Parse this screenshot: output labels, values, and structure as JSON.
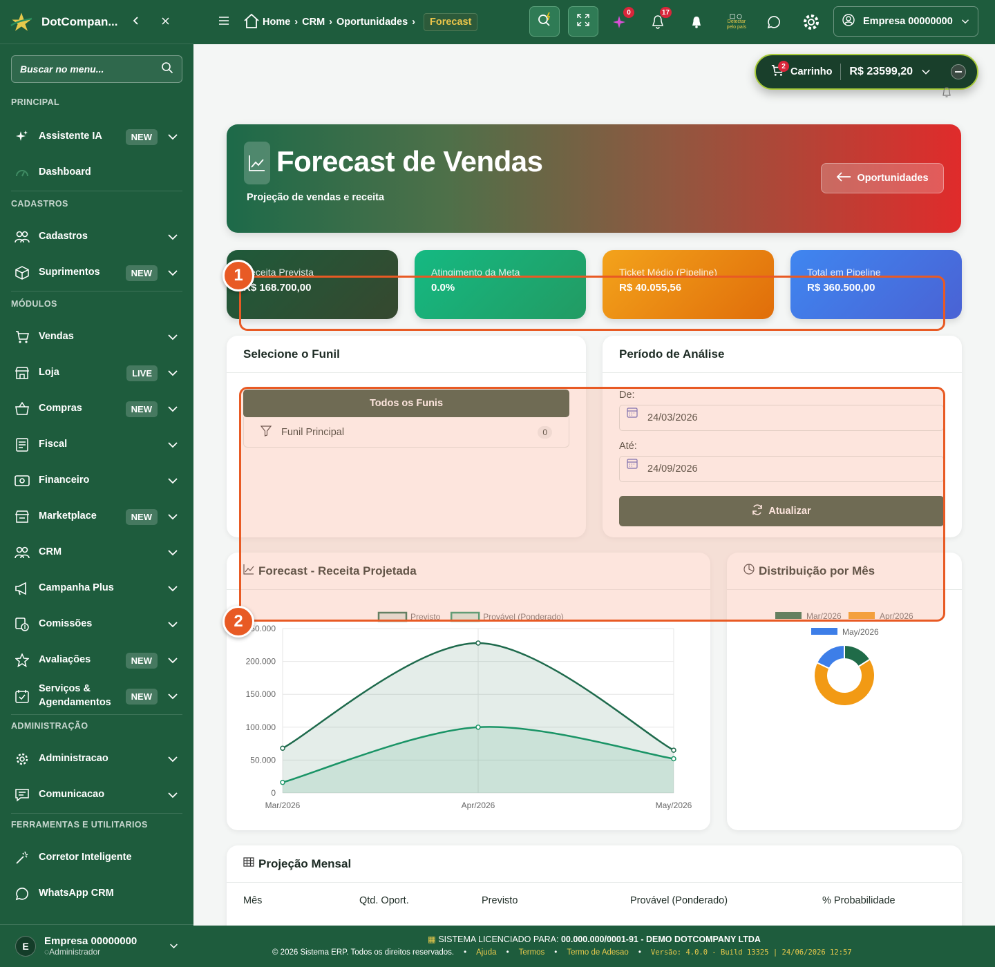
{
  "app": {
    "brand": "DotCompan..."
  },
  "sidebar": {
    "search_placeholder": "Buscar no menu...",
    "sections": {
      "principal": "PRINCIPAL",
      "cadastros": "CADASTROS",
      "modulos": "MÓDULOS",
      "administracao": "ADMINISTRAÇÃO",
      "ferramentas": "FERRAMENTAS E UTILITARIOS"
    },
    "items": {
      "assistente": {
        "label": "Assistente IA",
        "badge": "NEW"
      },
      "dashboard": {
        "label": "Dashboard"
      },
      "cadastros": {
        "label": "Cadastros"
      },
      "suprimentos": {
        "label": "Suprimentos",
        "badge": "NEW"
      },
      "vendas": {
        "label": "Vendas"
      },
      "loja": {
        "label": "Loja",
        "badge": "LIVE"
      },
      "compras": {
        "label": "Compras",
        "badge": "NEW"
      },
      "fiscal": {
        "label": "Fiscal"
      },
      "financeiro": {
        "label": "Financeiro"
      },
      "marketplace": {
        "label": "Marketplace",
        "badge": "NEW"
      },
      "crm": {
        "label": "CRM"
      },
      "campanha": {
        "label": "Campanha Plus"
      },
      "comissoes": {
        "label": "Comissões"
      },
      "avaliacoes": {
        "label": "Avaliações",
        "badge": "NEW"
      },
      "servicos": {
        "label": "Serviços & Agendamentos",
        "badge": "NEW"
      },
      "administracao": {
        "label": "Administracao"
      },
      "comunicacao": {
        "label": "Comunicacao"
      },
      "corretor": {
        "label": "Corretor Inteligente"
      },
      "whatsapp": {
        "label": "WhatsApp CRM"
      }
    },
    "user": {
      "initial": "E",
      "name": "Empresa 00000000",
      "role": "Administrador"
    }
  },
  "topbar": {
    "breadcrumbs": {
      "home": "Home",
      "crm": "CRM",
      "oportunidades": "Oportunidades",
      "active": "Forecast"
    },
    "badges": {
      "ai": "0",
      "notifications": "17"
    },
    "detect_label": "Detectar pelo país",
    "company": "Empresa 00000000"
  },
  "cart": {
    "count": "2",
    "label": "Carrinho",
    "value": "R$ 23599,20"
  },
  "hero": {
    "title": "Forecast de Vendas",
    "subtitle": "Projeção de vendas e receita",
    "back_button": "Oportunidades"
  },
  "kpis": [
    {
      "title": "Receita Prevista",
      "value": "R$ 168.700,00"
    },
    {
      "title": "Atingimento da Meta",
      "value": "0.0%"
    },
    {
      "title": "Ticket Médio (Pipeline)",
      "value": "R$ 40.055,56"
    },
    {
      "title": "Total em Pipeline",
      "value": "R$ 360.500,00"
    }
  ],
  "funnel": {
    "title": "Selecione o Funil",
    "all": "Todos os Funis",
    "items": [
      {
        "label": "Funil Principal",
        "count": "0"
      }
    ]
  },
  "period": {
    "title": "Período de Análise",
    "from_label": "De:",
    "from_value": "24/03/2026",
    "to_label": "Até:",
    "to_value": "24/09/2026",
    "refresh": "Atualizar"
  },
  "forecast_chart": {
    "title": "Forecast - Receita Projetada"
  },
  "donut_chart": {
    "title": "Distribuição por Mês"
  },
  "markers": {
    "one": "1",
    "two": "2"
  },
  "chart_data": [
    {
      "type": "area",
      "categories": [
        "Mar/2026",
        "Apr/2026",
        "May/2026"
      ],
      "series": [
        {
          "name": "Previsto",
          "values": [
            68000,
            228000,
            65000
          ],
          "color": "#1e6a4c"
        },
        {
          "name": "Provável (Ponderado)",
          "values": [
            16000,
            100000,
            52000
          ],
          "color": "#1a9466"
        }
      ],
      "y_ticks": [
        "0",
        "50.000",
        "100.000",
        "150.000",
        "200.000",
        "250.000"
      ],
      "ylim": [
        0,
        250000
      ],
      "legend": "top"
    },
    {
      "type": "pie",
      "labels": [
        "Mar/2026",
        "Apr/2026",
        "May/2026"
      ],
      "values": [
        16,
        66,
        18
      ],
      "colors": [
        "#1f6b48",
        "#f29a14",
        "#3d7ee8"
      ],
      "legend": "top"
    }
  ],
  "table": {
    "title": "Projeção Mensal",
    "headers": [
      "Mês",
      "Qtd. Oport.",
      "Previsto",
      "Provável (Ponderado)",
      "% Probabilidade"
    ]
  },
  "footer": {
    "license_prefix": "SISTEMA LICENCIADO PARA:",
    "license_value": "00.000.000/0001-91 - DEMO DOTCOMPANY LTDA",
    "copyright": "© 2026 Sistema ERP. Todos os direitos reservados.",
    "links": [
      "Ajuda",
      "Termos",
      "Termo de Adesao"
    ],
    "version": "Versão: 4.0.0 - Build 13325 | 24/06/2026 12:57"
  }
}
